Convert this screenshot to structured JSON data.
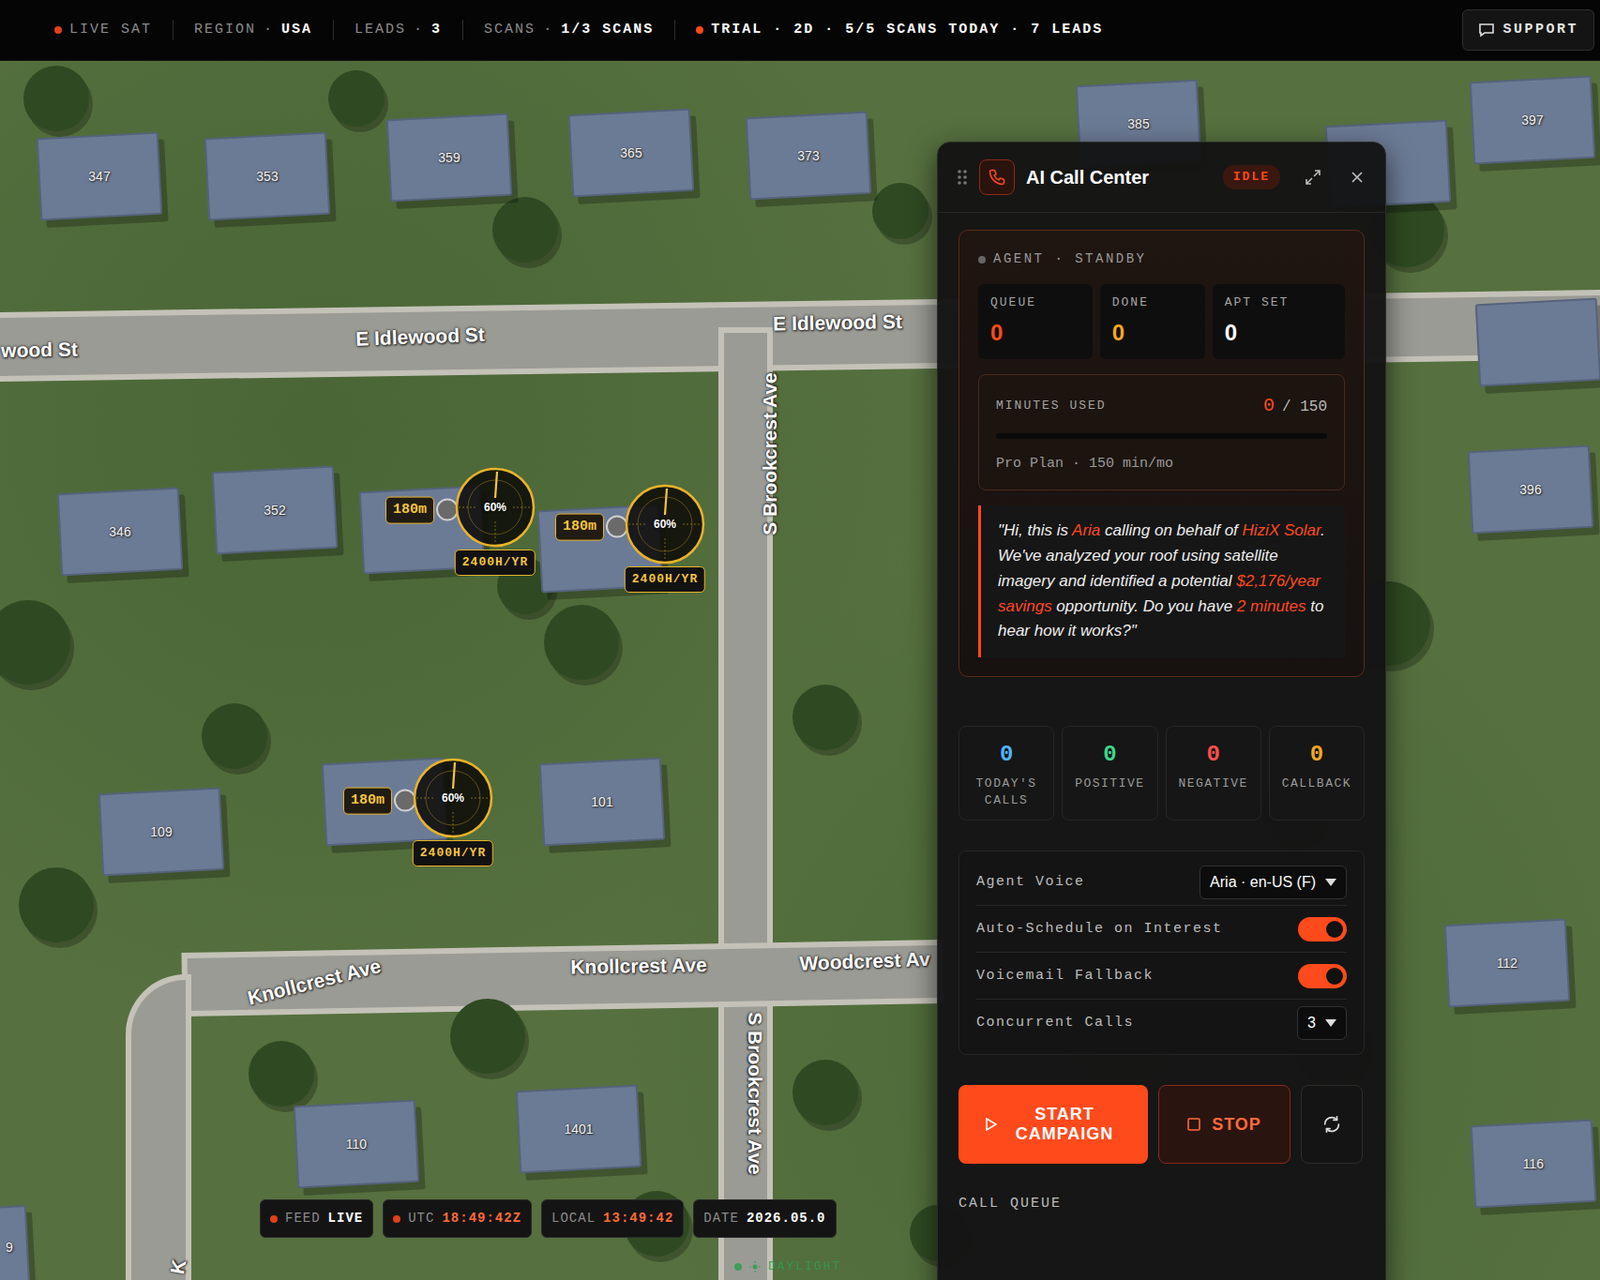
{
  "topbar": {
    "separator": "·",
    "items": [
      {
        "kind": "status",
        "text": "LIVE SAT"
      },
      {
        "kind": "pair",
        "label": "REGION",
        "value": "USA"
      },
      {
        "kind": "pair",
        "label": "LEADS",
        "value": "3"
      },
      {
        "kind": "pair",
        "label": "SCANS",
        "value": "1/3 SCANS"
      },
      {
        "kind": "trial",
        "text": "TRIAL · 2D · 5/5 SCANS TODAY · 7 LEADS"
      }
    ],
    "support": "SUPPORT"
  },
  "map": {
    "streets": [
      "E Idlewood St",
      "E Idlewood St",
      "wood St",
      "S Brookcrest Ave",
      "S Brookcrest Ave",
      "Knollcrest Ave",
      "Knollcrest Ave",
      "Woodcrest Av",
      "K"
    ],
    "houses": [
      "347",
      "353",
      "359",
      "365",
      "373",
      "385",
      "397",
      "352",
      "346",
      "396",
      "109",
      "101",
      "112",
      "110",
      "1401",
      "116",
      "9"
    ],
    "markers": [
      {
        "area": "180m",
        "gauge": "60%",
        "hours": "2400H/YR"
      },
      {
        "area": "180m",
        "gauge": "60%",
        "hours": "2400H/YR"
      },
      {
        "area": "180m",
        "gauge": "60%",
        "hours": "2400H/YR"
      }
    ]
  },
  "status_chips": [
    {
      "label": "FEED",
      "value": "LIVE",
      "dot": true,
      "color": "#ffffff"
    },
    {
      "label": "UTC",
      "value": "18:49:42Z",
      "dot": true,
      "color": "#ff6a3a"
    },
    {
      "label": "LOCAL",
      "value": "13:49:42",
      "dot": false,
      "color": "#ff6a3a"
    },
    {
      "label": "DATE",
      "value": "2026.05.0",
      "dot": false,
      "color": "#ffffff"
    }
  ],
  "daylight": "DAYLIGHT",
  "call_center": {
    "title": "AI Call Center",
    "status": "IDLE",
    "agent": "AGENT · STANDBY",
    "stats": [
      {
        "label": "QUEUE",
        "value": "0",
        "color": "#ff4a1c"
      },
      {
        "label": "DONE",
        "value": "0",
        "color": "#f5a623"
      },
      {
        "label": "APT SET",
        "value": "0",
        "color": "#ffffff"
      }
    ],
    "minutes": {
      "label": "MINUTES USED",
      "used": "0",
      "total": "/ 150",
      "level": 0,
      "plan": "Pro Plan · 150 min/mo"
    },
    "script": [
      {
        "text": "\"Hi, this is ",
        "highlight": false
      },
      {
        "text": "Aria",
        "highlight": true
      },
      {
        "text": " calling on behalf of ",
        "highlight": false
      },
      {
        "text": "HiziX Solar",
        "highlight": true
      },
      {
        "text": ". We've analyzed your roof using satellite imagery and identified a potential ",
        "highlight": false
      },
      {
        "text": "$2,176/year savings",
        "highlight": true
      },
      {
        "text": " opportunity. Do you have ",
        "highlight": false
      },
      {
        "text": "2 minutes",
        "highlight": true
      },
      {
        "text": " to hear how it works?\"",
        "highlight": false
      }
    ],
    "counters": [
      {
        "label": "TODAY'S CALLS",
        "value": "0",
        "color": "#4fb3ff"
      },
      {
        "label": "POSITIVE",
        "value": "0",
        "color": "#3fd68a"
      },
      {
        "label": "NEGATIVE",
        "value": "0",
        "color": "#ff4d4d"
      },
      {
        "label": "CALLBACK",
        "value": "0",
        "color": "#f5a623"
      }
    ],
    "settings": [
      {
        "kind": "select",
        "label": "Agent Voice",
        "value": "Aria · en-US (F)"
      },
      {
        "kind": "toggle",
        "label": "Auto-Schedule on Interest",
        "on": true
      },
      {
        "kind": "toggle",
        "label": "Voicemail Fallback",
        "on": true
      },
      {
        "kind": "select",
        "label": "Concurrent Calls",
        "value": "3"
      }
    ],
    "buttons": {
      "start": "START CAMPAIGN",
      "stop": "STOP"
    },
    "queue_label": "CALL QUEUE"
  }
}
